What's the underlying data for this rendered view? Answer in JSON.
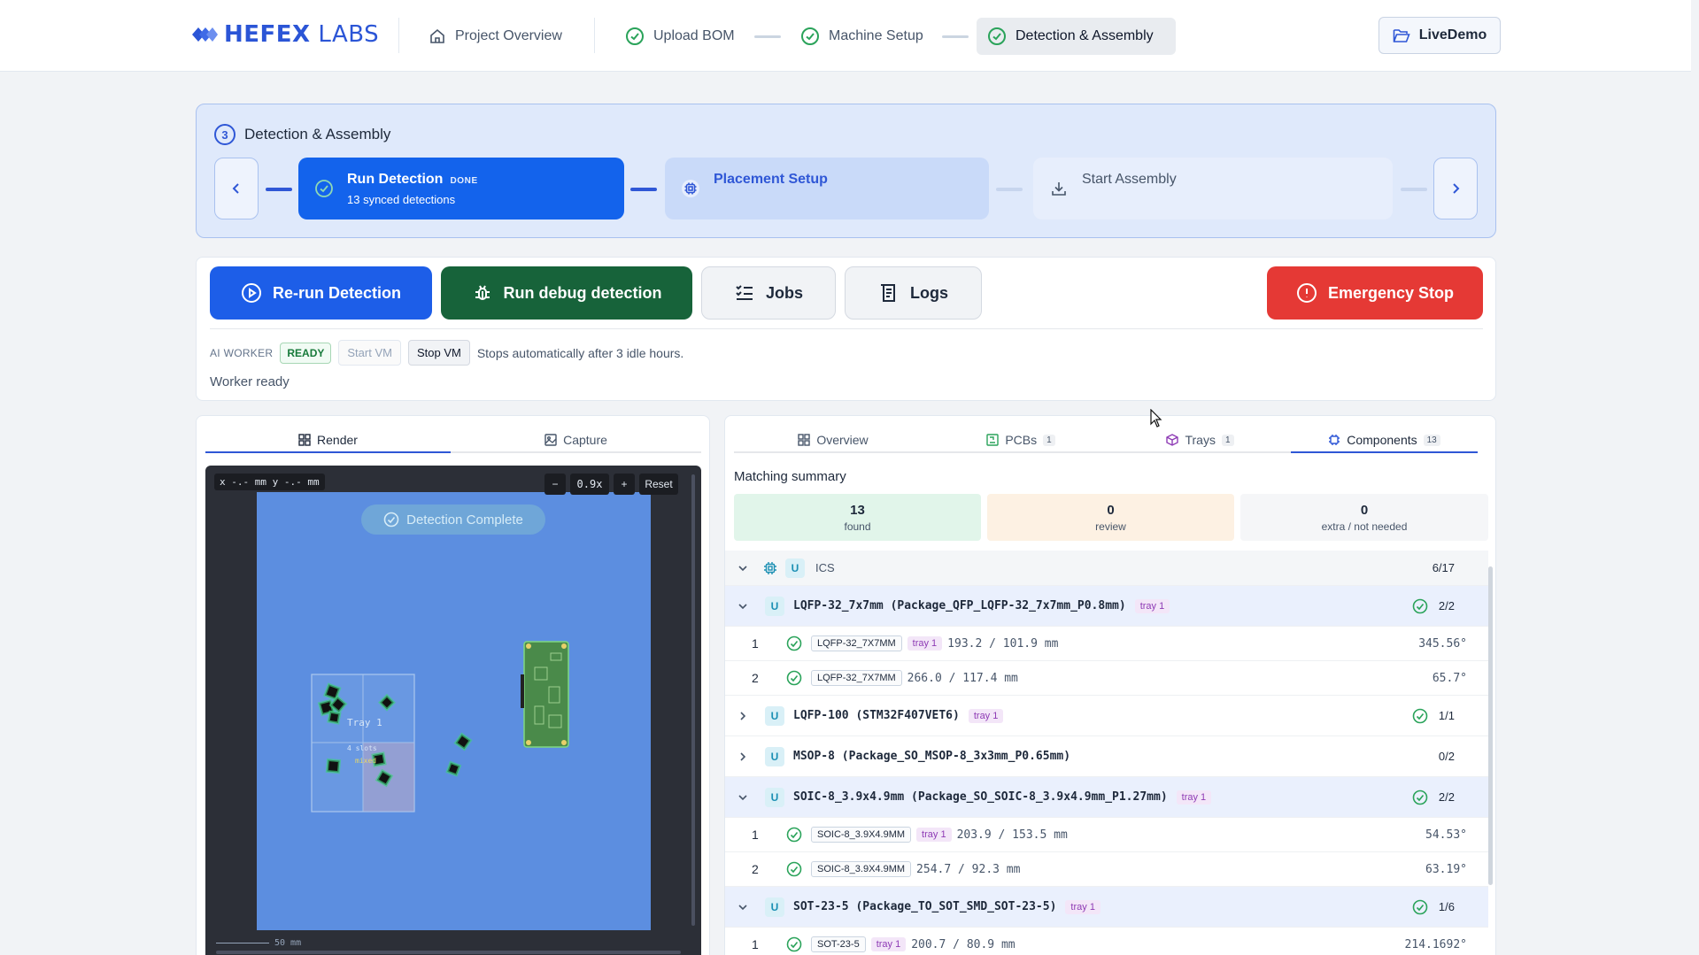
{
  "header": {
    "brand_bold": "HEFEX",
    "brand_light": "LABS",
    "project_overview": "Project Overview",
    "steps": [
      "Upload BOM",
      "Machine Setup",
      "Detection & Assembly"
    ],
    "live_demo": "LiveDemo"
  },
  "stepper": {
    "number": "3",
    "title": "Detection & Assembly",
    "run_detection": {
      "title": "Run Detection",
      "badge": "DONE",
      "subtitle": "13 synced detections"
    },
    "placement_setup": {
      "title": "Placement Setup"
    },
    "start_assembly": {
      "title": "Start Assembly"
    }
  },
  "actions": {
    "rerun": "Re-run Detection",
    "debug": "Run debug detection",
    "jobs": "Jobs",
    "logs": "Logs",
    "estop": "Emergency Stop"
  },
  "worker": {
    "label": "AI WORKER",
    "status_badge": "READY",
    "start_vm": "Start VM",
    "stop_vm": "Stop VM",
    "note": "Stops automatically after 3 idle hours.",
    "status": "Worker ready"
  },
  "viewer": {
    "tabs": [
      "Render",
      "Capture"
    ],
    "coord_readout": "x -.- mm y -.- mm",
    "zoom_out": "−",
    "zoom_level": "0.9x",
    "zoom_in": "+",
    "reset": "Reset",
    "detection_badge": "Detection Complete",
    "tray_label": "Tray 1",
    "slots_label": "4 slots",
    "mixed_label": "mixed",
    "scale_label": "50 mm"
  },
  "results": {
    "tabs": [
      {
        "label": "Overview",
        "count": ""
      },
      {
        "label": "PCBs",
        "count": "1"
      },
      {
        "label": "Trays",
        "count": "1"
      },
      {
        "label": "Components",
        "count": "13"
      }
    ],
    "summary_title": "Matching summary",
    "summary": [
      {
        "value": "13",
        "label": "found"
      },
      {
        "value": "0",
        "label": "review"
      },
      {
        "value": "0",
        "label": "extra / not needed"
      }
    ],
    "group": {
      "badge": "U",
      "name": "ICS",
      "count": "6/17"
    },
    "packages": [
      {
        "name": "LQFP-32_7x7mm (Package_QFP_LQFP-32_7x7mm_P0.8mm)",
        "tray": "tray 1",
        "count": "2/2",
        "items": [
          {
            "idx": "1",
            "part": "LQFP-32_7X7MM",
            "tray": "tray 1",
            "coords": "193.2 / 101.9 mm",
            "angle": "345.56°"
          },
          {
            "idx": "2",
            "part": "LQFP-32_7X7MM",
            "tray": "",
            "coords": "266.0 / 117.4 mm",
            "angle": "65.7°"
          }
        ]
      },
      {
        "name": "LQFP-100 (STM32F407VET6)",
        "tray": "tray 1",
        "count": "1/1",
        "items": []
      },
      {
        "name": "MSOP-8 (Package_SO_MSOP-8_3x3mm_P0.65mm)",
        "tray": "",
        "count": "0/2",
        "items": []
      },
      {
        "name": "SOIC-8_3.9x4.9mm (Package_SO_SOIC-8_3.9x4.9mm_P1.27mm)",
        "tray": "tray 1",
        "count": "2/2",
        "items": [
          {
            "idx": "1",
            "part": "SOIC-8_3.9X4.9MM",
            "tray": "tray 1",
            "coords": "203.9 / 153.5 mm",
            "angle": "54.53°"
          },
          {
            "idx": "2",
            "part": "SOIC-8_3.9X4.9MM",
            "tray": "",
            "coords": "254.7 / 92.3 mm",
            "angle": "63.19°"
          }
        ]
      },
      {
        "name": "SOT-23-5 (Package_TO_SOT_SMD_SOT-23-5)",
        "tray": "tray 1",
        "count": "1/6",
        "items": [
          {
            "idx": "1",
            "part": "SOT-23-5",
            "tray": "tray 1",
            "coords": "200.7 / 80.9 mm",
            "angle": "214.1692°"
          }
        ]
      }
    ]
  },
  "colors": {
    "brand": "#2b55d6",
    "primary": "#1d5ee8",
    "success": "#17633a",
    "danger": "#e53935",
    "board": "#5c8ee0"
  }
}
